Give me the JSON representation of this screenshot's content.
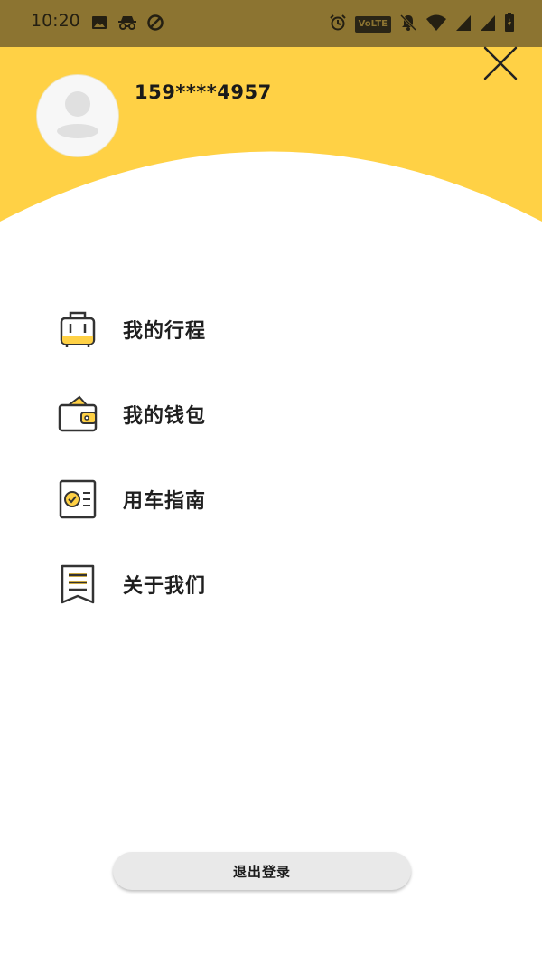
{
  "status_bar": {
    "time": "10:20",
    "volte": "VoLTE",
    "icons_left": [
      "image-icon",
      "incognito-icon",
      "data-saver-icon"
    ],
    "icons_right": [
      "alarm-icon",
      "volte-badge",
      "mute-icon",
      "wifi-icon",
      "signal-icon",
      "signal-icon",
      "battery-icon"
    ]
  },
  "colors": {
    "accent": "#ffd145",
    "status_bar": "#8c7431",
    "icon_stroke": "#333333"
  },
  "user": {
    "phone": "159****4957"
  },
  "menu": {
    "items": [
      {
        "label": "我的行程",
        "icon": "luggage-icon"
      },
      {
        "label": "我的钱包",
        "icon": "wallet-icon"
      },
      {
        "label": "用车指南",
        "icon": "guide-icon"
      },
      {
        "label": "关于我们",
        "icon": "about-icon"
      }
    ]
  },
  "logout": {
    "label": "退出登录"
  }
}
